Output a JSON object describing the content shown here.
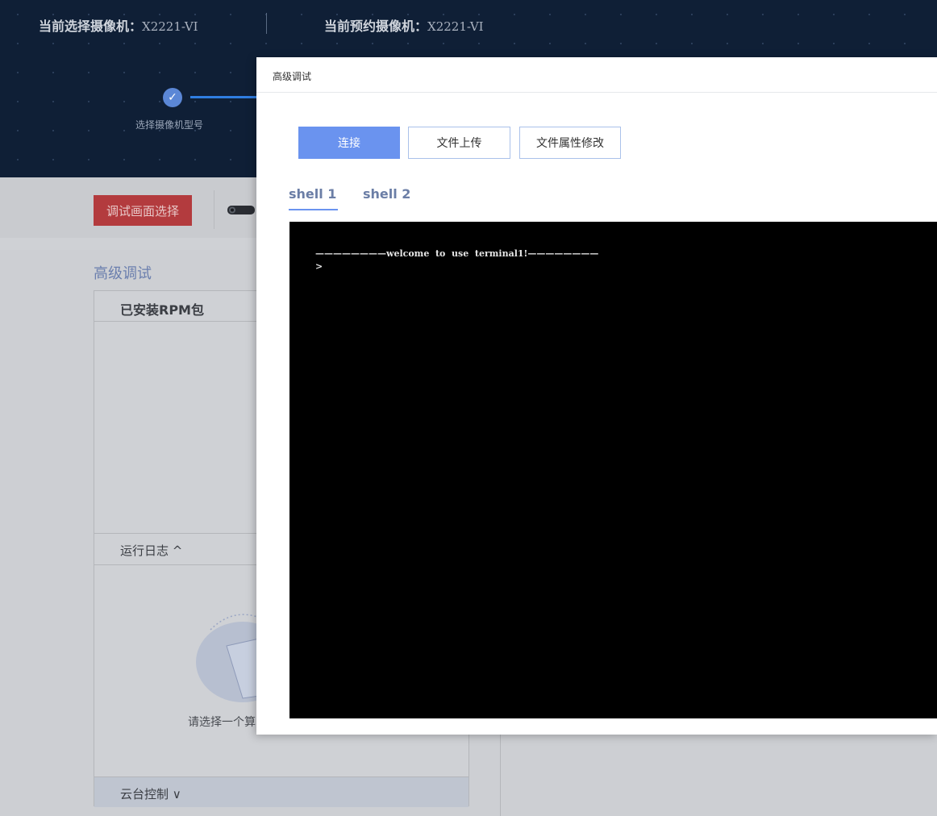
{
  "header": {
    "current_selected_label": "当前选择摄像机：",
    "current_selected_value": "X2221-VI",
    "current_reserved_label": "当前预约摄像机：",
    "current_reserved_value": "X2221-VI"
  },
  "steps": [
    {
      "label": "选择摄像机型号",
      "status": "done"
    }
  ],
  "toolbar": {
    "debug_select_label": "调试画面选择"
  },
  "page": {
    "section_title": "高级调试",
    "rpm_title": "已安装RPM包",
    "log_title": "运行日志 ^",
    "empty_text": "请选择一个算",
    "ptz_title": "云台控制 ∨"
  },
  "modal": {
    "title": "高级调试",
    "buttons": {
      "connect": "连接",
      "upload": "文件上传",
      "attr_modify": "文件属性修改"
    },
    "tabs": [
      {
        "label": "shell 1",
        "active": true
      },
      {
        "label": "shell 2",
        "active": false
      }
    ],
    "terminal": {
      "lines": [
        "————————welcome  to  use  terminal1!————————",
        ">"
      ]
    }
  },
  "colors": {
    "topbar_bg": "#0f1f36",
    "primary": "#6a93ef",
    "danger": "#b33b3e",
    "terminal_bg": "#000000"
  }
}
